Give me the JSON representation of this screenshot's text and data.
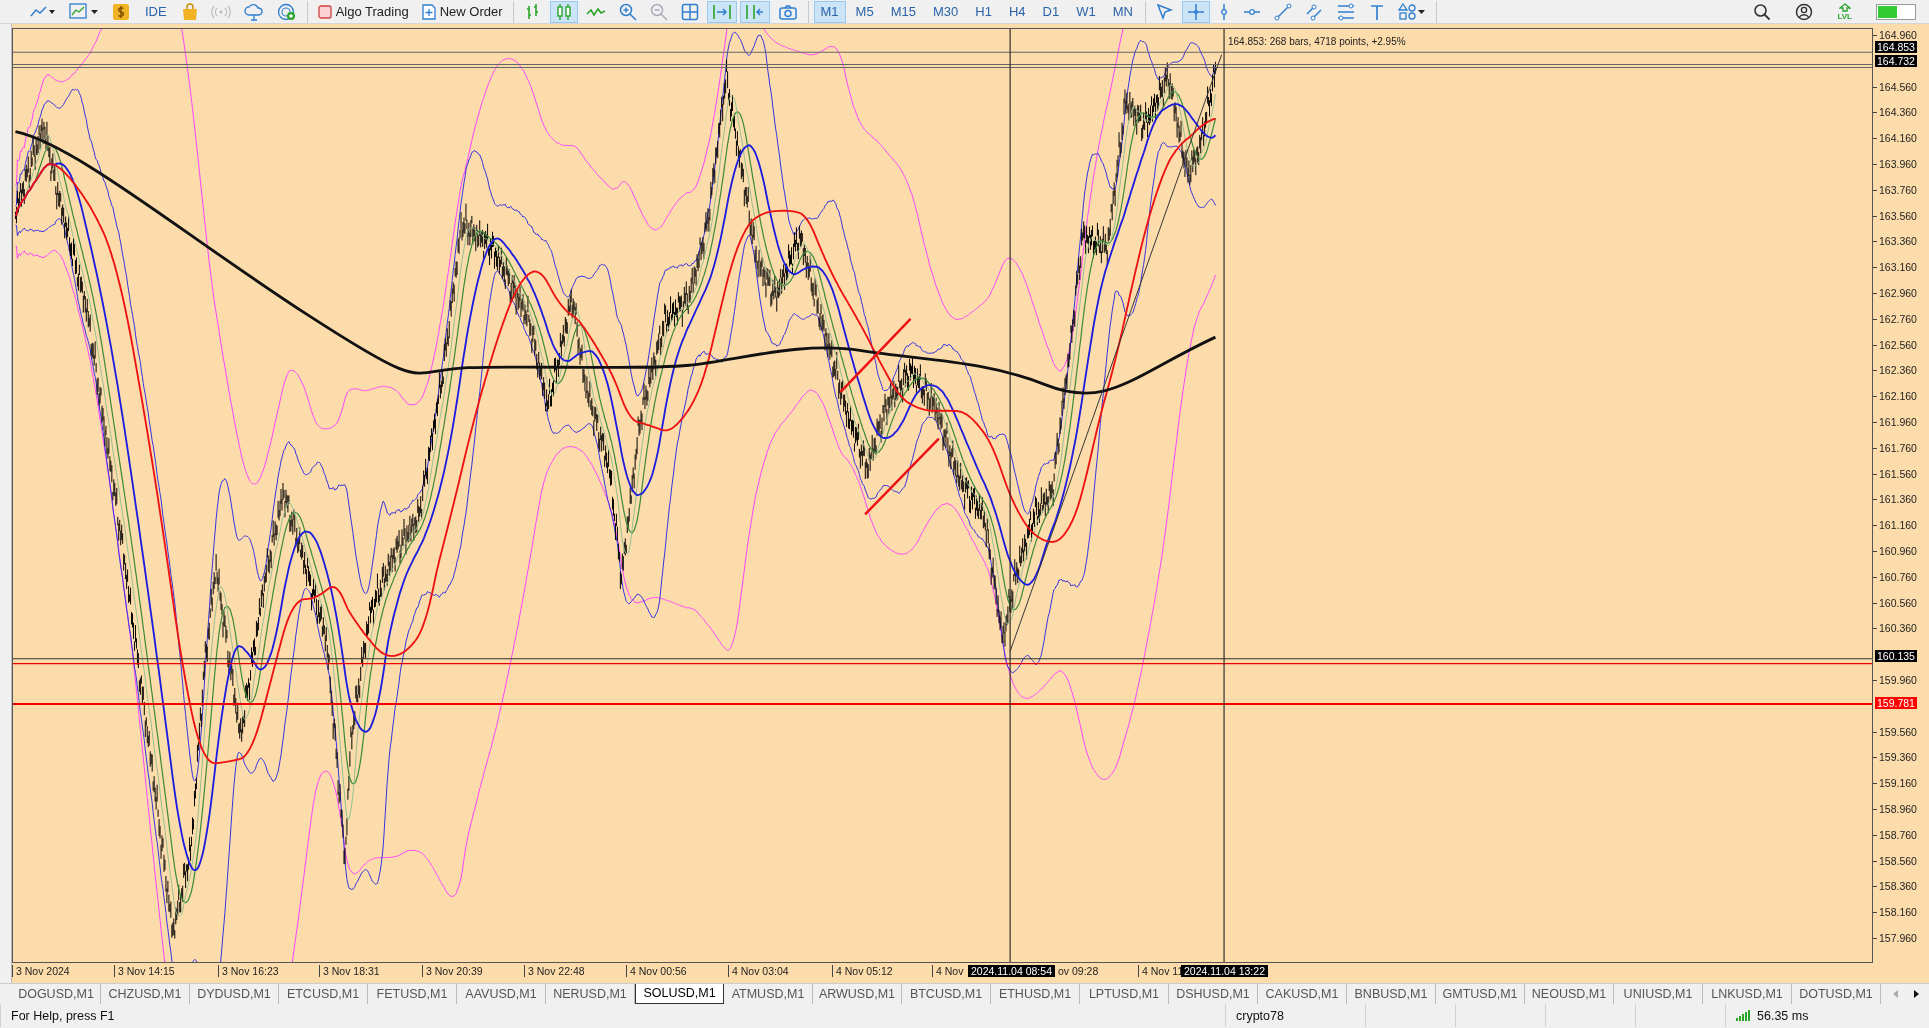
{
  "toolbar": {
    "groups": [
      [
        {
          "kind": "linechart",
          "selected": false
        },
        {
          "kind": "indicators",
          "selected": false
        },
        {
          "kind": "dollar",
          "selected": false
        },
        {
          "kind": "text",
          "label": "IDE",
          "selected": false
        },
        {
          "kind": "bag",
          "selected": false
        },
        {
          "kind": "signal",
          "selected": false
        },
        {
          "kind": "cloud",
          "selected": false
        },
        {
          "kind": "vps",
          "selected": false
        }
      ],
      [
        {
          "kind": "algo",
          "label": "Algo Trading",
          "selected": false
        },
        {
          "kind": "order",
          "label": "New Order",
          "selected": false
        }
      ],
      [
        {
          "kind": "bars",
          "selected": false
        },
        {
          "kind": "candles",
          "selected": true
        },
        {
          "kind": "line",
          "selected": false
        },
        {
          "kind": "zoomin",
          "selected": false
        },
        {
          "kind": "zoomout",
          "selected": false
        },
        {
          "kind": "grid",
          "selected": false
        },
        {
          "kind": "autoscroll",
          "selected": true
        },
        {
          "kind": "shift",
          "selected": true
        },
        {
          "kind": "camera",
          "selected": false
        }
      ],
      [
        {
          "kind": "text",
          "label": "M1",
          "selected": true
        },
        {
          "kind": "text",
          "label": "M5",
          "selected": false
        },
        {
          "kind": "text",
          "label": "M15",
          "selected": false
        },
        {
          "kind": "text",
          "label": "M30",
          "selected": false
        },
        {
          "kind": "text",
          "label": "H1",
          "selected": false
        },
        {
          "kind": "text",
          "label": "H4",
          "selected": false
        },
        {
          "kind": "text",
          "label": "D1",
          "selected": false
        },
        {
          "kind": "text",
          "label": "W1",
          "selected": false
        },
        {
          "kind": "text",
          "label": "MN",
          "selected": false
        }
      ],
      [
        {
          "kind": "cursor",
          "selected": false
        },
        {
          "kind": "crosshair",
          "selected": true
        },
        {
          "kind": "vline",
          "selected": false
        },
        {
          "kind": "hline",
          "selected": false
        },
        {
          "kind": "trend",
          "selected": false
        },
        {
          "kind": "channel",
          "selected": false
        },
        {
          "kind": "fibo",
          "selected": false
        },
        {
          "kind": "texttool",
          "selected": false
        },
        {
          "kind": "shapes",
          "selected": false
        }
      ]
    ],
    "right": [
      {
        "kind": "search",
        "selected": false
      },
      {
        "kind": "account",
        "selected": false
      },
      {
        "kind": "lvl",
        "label": "LVL",
        "selected": false
      },
      {
        "kind": "meter",
        "selected": false
      }
    ]
  },
  "chart": {
    "price_axis": [
      "164.960",
      "164.560",
      "164.360",
      "164.160",
      "163.960",
      "163.760",
      "163.560",
      "163.360",
      "163.160",
      "162.960",
      "162.760",
      "162.560",
      "162.360",
      "162.160",
      "161.960",
      "161.760",
      "161.560",
      "161.360",
      "161.160",
      "160.960",
      "160.760",
      "160.560",
      "160.360",
      "159.960",
      "159.560",
      "159.360",
      "159.160",
      "158.960",
      "158.760",
      "158.560",
      "158.360",
      "158.160",
      "157.960"
    ],
    "price_tags": [
      {
        "text": "164.853",
        "color": "#000000"
      },
      {
        "text": "164.732",
        "color": "#000000"
      },
      {
        "text": "160.135",
        "color": "#000000"
      },
      {
        "text": "159.781",
        "color": "#ff0000"
      }
    ],
    "ruler_label": "164.853: 268 bars, 4718 points, +2.95%",
    "time_axis": [
      "3 Nov 2024",
      "3 Nov 14:15",
      "3 Nov 16:23",
      "3 Nov 18:31",
      "3 Nov 20:39",
      "3 Nov 22:48",
      "4 Nov 00:56",
      "4 Nov 03:04",
      "4 Nov 05:12",
      "4 Nov",
      "ov 09:28",
      "4 Nov 11"
    ],
    "crosshair_times": [
      "2024.11.04 08:54",
      "2024.11.04 13:22"
    ]
  },
  "tabs": [
    {
      "label": "DOGUSD,M1",
      "selected": false
    },
    {
      "label": "CHZUSD,M1",
      "selected": false
    },
    {
      "label": "DYDUSD,M1",
      "selected": false
    },
    {
      "label": "ETCUSD,M1",
      "selected": false
    },
    {
      "label": "FETUSD,M1",
      "selected": false
    },
    {
      "label": "AAVUSD,M1",
      "selected": false
    },
    {
      "label": "NERUSD,M1",
      "selected": false
    },
    {
      "label": "SOLUSD,M1",
      "selected": true
    },
    {
      "label": "ATMUSD,M1",
      "selected": false
    },
    {
      "label": "ARWUSD,M1",
      "selected": false
    },
    {
      "label": "BTCUSD,M1",
      "selected": false
    },
    {
      "label": "ETHUSD,M1",
      "selected": false
    },
    {
      "label": "LPTUSD,M1",
      "selected": false
    },
    {
      "label": "DSHUSD,M1",
      "selected": false
    },
    {
      "label": "CAKUSD,M1",
      "selected": false
    },
    {
      "label": "BNBUSD,M1",
      "selected": false
    },
    {
      "label": "GMTUSD,M1",
      "selected": false
    },
    {
      "label": "NEOUSD,M1",
      "selected": false
    },
    {
      "label": "UNIUSD,M1",
      "selected": false
    },
    {
      "label": "LNKUSD,M1",
      "selected": false
    },
    {
      "label": "DOTUSD,M1",
      "selected": false
    }
  ],
  "status_bar": {
    "help": "For Help, press F1",
    "profile": "crypto78",
    "ping": "56.35 ms"
  }
}
